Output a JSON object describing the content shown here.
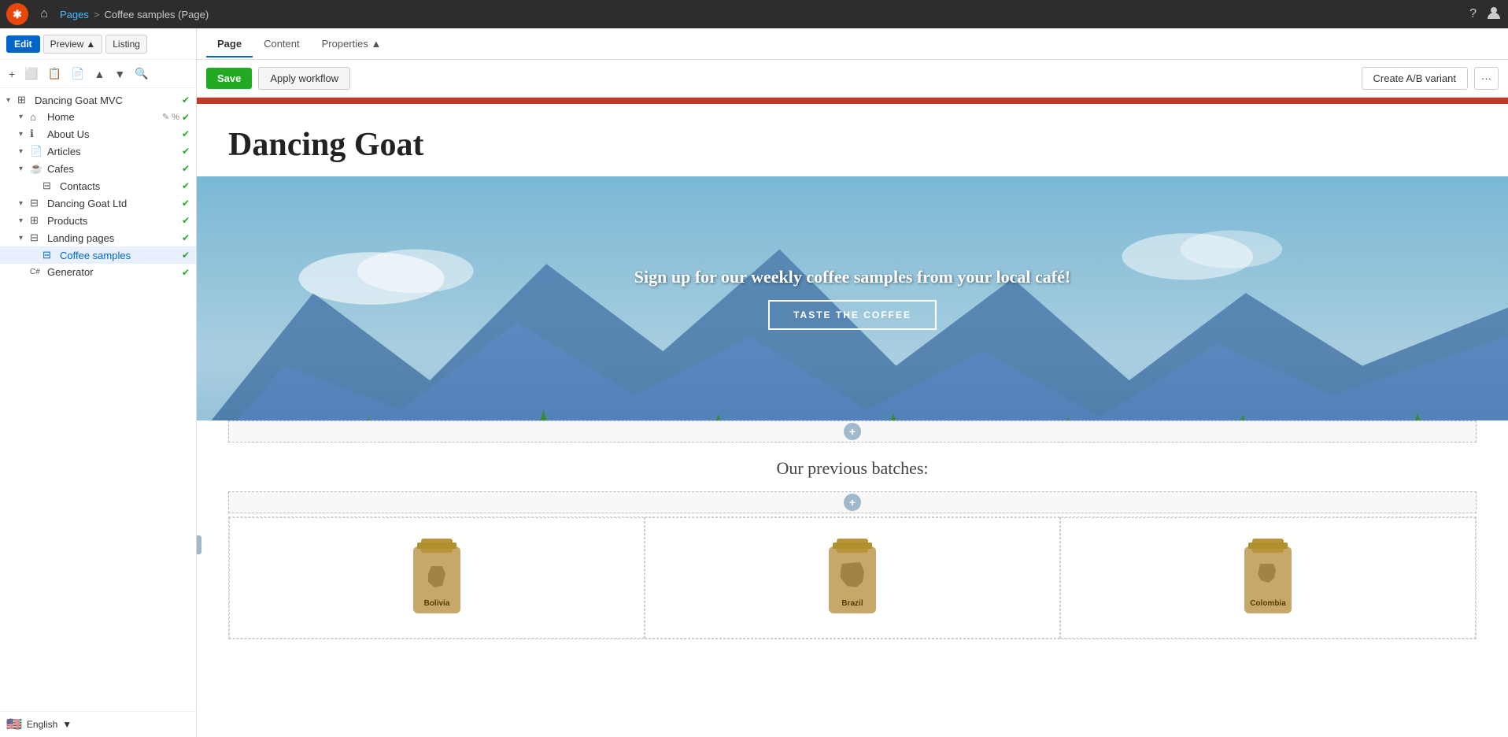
{
  "topbar": {
    "logo_text": "✱",
    "home_icon": "⌂",
    "site_name": "Dancing Goat MVC",
    "breadcrumb_sep": ">",
    "breadcrumb_pages": "Pages",
    "breadcrumb_current": "Coffee samples (Page)",
    "help_icon": "?",
    "user_icon": "👤"
  },
  "sidebar": {
    "edit_label": "Edit",
    "preview_label": "Preview",
    "listing_label": "Listing",
    "actions": {
      "add": "+",
      "move_up": "▲",
      "move_down": "▼",
      "search": "🔍"
    },
    "tree": [
      {
        "id": "dancing-goat-mvc",
        "label": "Dancing Goat MVC",
        "type": "site",
        "indent": 0,
        "expanded": true,
        "status": "green"
      },
      {
        "id": "home",
        "label": "Home",
        "type": "home",
        "indent": 1,
        "status": "green",
        "extra": "edit"
      },
      {
        "id": "about-us",
        "label": "About Us",
        "type": "page",
        "indent": 1,
        "status": "green"
      },
      {
        "id": "articles",
        "label": "Articles",
        "type": "page",
        "indent": 1,
        "status": "green"
      },
      {
        "id": "cafes",
        "label": "Cafes",
        "type": "page",
        "indent": 1,
        "status": "green"
      },
      {
        "id": "contacts",
        "label": "Contacts",
        "type": "page",
        "indent": 2,
        "status": "green"
      },
      {
        "id": "dancing-goat-ltd",
        "label": "Dancing Goat Ltd",
        "type": "page",
        "indent": 1,
        "status": "green"
      },
      {
        "id": "products",
        "label": "Products",
        "type": "page",
        "indent": 1,
        "status": "green"
      },
      {
        "id": "landing-pages",
        "label": "Landing pages",
        "type": "folder",
        "indent": 1,
        "expanded": true,
        "status": "green"
      },
      {
        "id": "coffee-samples",
        "label": "Coffee samples",
        "type": "page",
        "indent": 2,
        "status": "green",
        "selected": true
      },
      {
        "id": "generator",
        "label": "Generator",
        "type": "component",
        "indent": 1,
        "status": "green"
      }
    ],
    "footer": {
      "language": "English",
      "dropdown_arrow": "▼"
    }
  },
  "content_tabs": [
    {
      "id": "page",
      "label": "Page",
      "active": true
    },
    {
      "id": "content",
      "label": "Content",
      "active": false
    },
    {
      "id": "properties",
      "label": "Properties ▲",
      "active": false
    }
  ],
  "toolbar": {
    "save_label": "Save",
    "workflow_label": "Apply workflow",
    "ab_label": "Create A/B variant",
    "more_label": "···"
  },
  "page": {
    "site_title": "Dancing Goat",
    "hero_text": "Sign up for our weekly coffee samples from your local café!",
    "hero_btn": "TASTE THE COFFEE",
    "batches_title": "Our previous batches:",
    "products": [
      {
        "id": "bolivia",
        "country": "Bolivia",
        "map_char": "🗺"
      },
      {
        "id": "brazil",
        "country": "Brazil",
        "map_char": "🗺"
      },
      {
        "id": "colombia",
        "country": "Colombia",
        "map_char": "🗺"
      }
    ]
  }
}
